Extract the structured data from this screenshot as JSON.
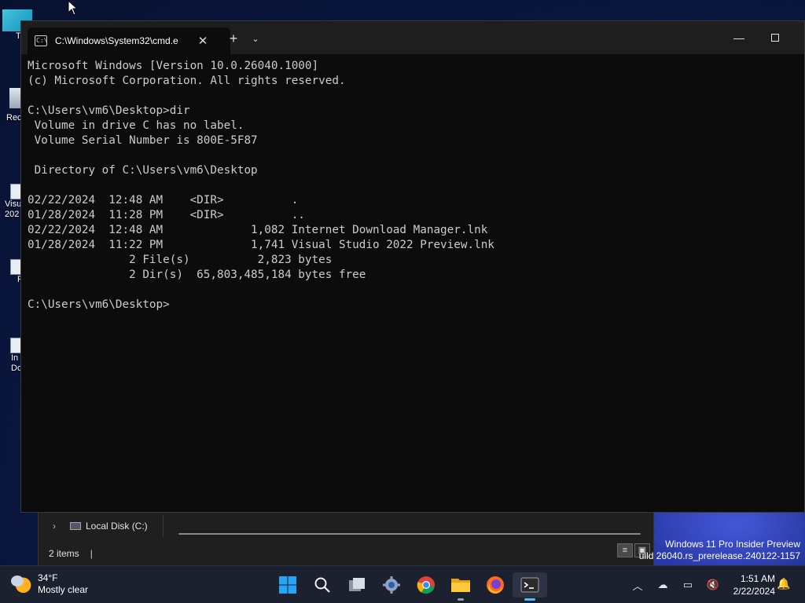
{
  "desktop": {
    "icons": [
      {
        "label": "T"
      },
      {
        "label": "Rec"
      },
      {
        "label": "Visu\n202"
      },
      {
        "label": "F"
      },
      {
        "label": "In\nDo"
      }
    ],
    "watermark": {
      "line1": "Windows 11 Pro Insider Preview",
      "line2": "uild 26040.rs_prerelease.240122-1157"
    }
  },
  "explorer": {
    "nav_item": "Local Disk (C:)",
    "status": "2 items",
    "status_sep": "|"
  },
  "terminal": {
    "tab_title": "C:\\Windows\\System32\\cmd.e",
    "tab_icon": "cmd-icon",
    "lines": [
      "Microsoft Windows [Version 10.0.26040.1000]",
      "(c) Microsoft Corporation. All rights reserved.",
      "",
      "C:\\Users\\vm6\\Desktop>dir",
      " Volume in drive C has no label.",
      " Volume Serial Number is 800E-5F87",
      "",
      " Directory of C:\\Users\\vm6\\Desktop",
      "",
      "02/22/2024  12:48 AM    <DIR>          .",
      "01/28/2024  11:28 PM    <DIR>          ..",
      "02/22/2024  12:48 AM             1,082 Internet Download Manager.lnk",
      "01/28/2024  11:22 PM             1,741 Visual Studio 2022 Preview.lnk",
      "               2 File(s)          2,823 bytes",
      "               2 Dir(s)  65,803,485,184 bytes free",
      "",
      "C:\\Users\\vm6\\Desktop>"
    ]
  },
  "taskbar": {
    "weather": {
      "temp": "34°F",
      "condition": "Mostly clear"
    },
    "apps": [
      {
        "name": "start-button"
      },
      {
        "name": "search"
      },
      {
        "name": "task-view"
      },
      {
        "name": "settings"
      },
      {
        "name": "chrome"
      },
      {
        "name": "file-explorer"
      },
      {
        "name": "firefox"
      },
      {
        "name": "terminal"
      }
    ],
    "clock": {
      "time": "1:51 AM",
      "date": "2/22/2024"
    }
  },
  "colors": {
    "console_bg": "#0c0c0c",
    "console_fg": "#cccccc",
    "accent": "#4cc2ff"
  }
}
